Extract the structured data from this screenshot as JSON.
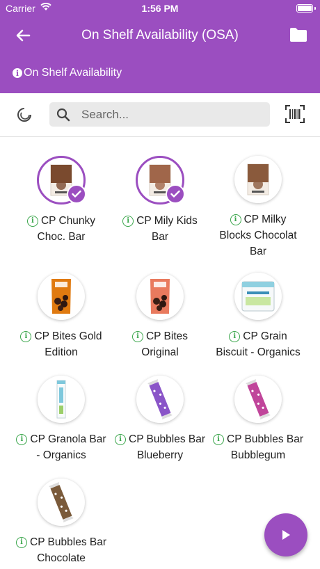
{
  "status_bar": {
    "carrier": "Carrier",
    "time": "1:56 PM"
  },
  "app_bar": {
    "title": "On Shelf Availability (OSA)",
    "subtitle": "On Shelf Availability",
    "back_icon": "arrow-left-icon",
    "folder_icon": "folder-icon"
  },
  "search": {
    "placeholder": "Search...",
    "value": ""
  },
  "colors": {
    "primary": "#9b4ec0",
    "info_green": "#3aa64b"
  },
  "products": [
    {
      "line1": "CP Chunky",
      "line2": "Choc. Bar",
      "line3": "",
      "selected": true,
      "color": "#7a4a2e",
      "kind": "box"
    },
    {
      "line1": "CP Mily Kids",
      "line2": "Bar",
      "line3": "",
      "selected": true,
      "color": "#a0664a",
      "kind": "box"
    },
    {
      "line1": "CP Milky",
      "line2": "Blocks Chocolat",
      "line3": "Bar",
      "selected": false,
      "color": "#8a5a3c",
      "kind": "box"
    },
    {
      "line1": "CP Bites Gold",
      "line2": "Edition",
      "line3": "",
      "selected": false,
      "color": "#e07a10",
      "kind": "bag"
    },
    {
      "line1": "CP Bites",
      "line2": "Original",
      "line3": "",
      "selected": false,
      "color": "#e97a5e",
      "kind": "bag"
    },
    {
      "line1": "CP Grain",
      "line2": "Biscuit - Organics",
      "line3": "",
      "selected": false,
      "color": "#8fd0e0",
      "kind": "pack"
    },
    {
      "line1": "CP Granola Bar",
      "line2": "- Organics",
      "line3": "",
      "selected": false,
      "color": "#7ec8dc",
      "kind": "stick"
    },
    {
      "line1": "CP Bubbles Bar",
      "line2": "Blueberry",
      "line3": "",
      "selected": false,
      "color": "#8a55c8",
      "kind": "bar"
    },
    {
      "line1": "CP Bubbles Bar",
      "line2": "Bubblegum",
      "line3": "",
      "selected": false,
      "color": "#c0459a",
      "kind": "bar"
    },
    {
      "line1": "CP Bubbles Bar",
      "line2": "Chocolate",
      "line3": "",
      "selected": false,
      "color": "#7a5a3a",
      "kind": "bar"
    }
  ],
  "fab": {
    "icon": "play-icon"
  }
}
